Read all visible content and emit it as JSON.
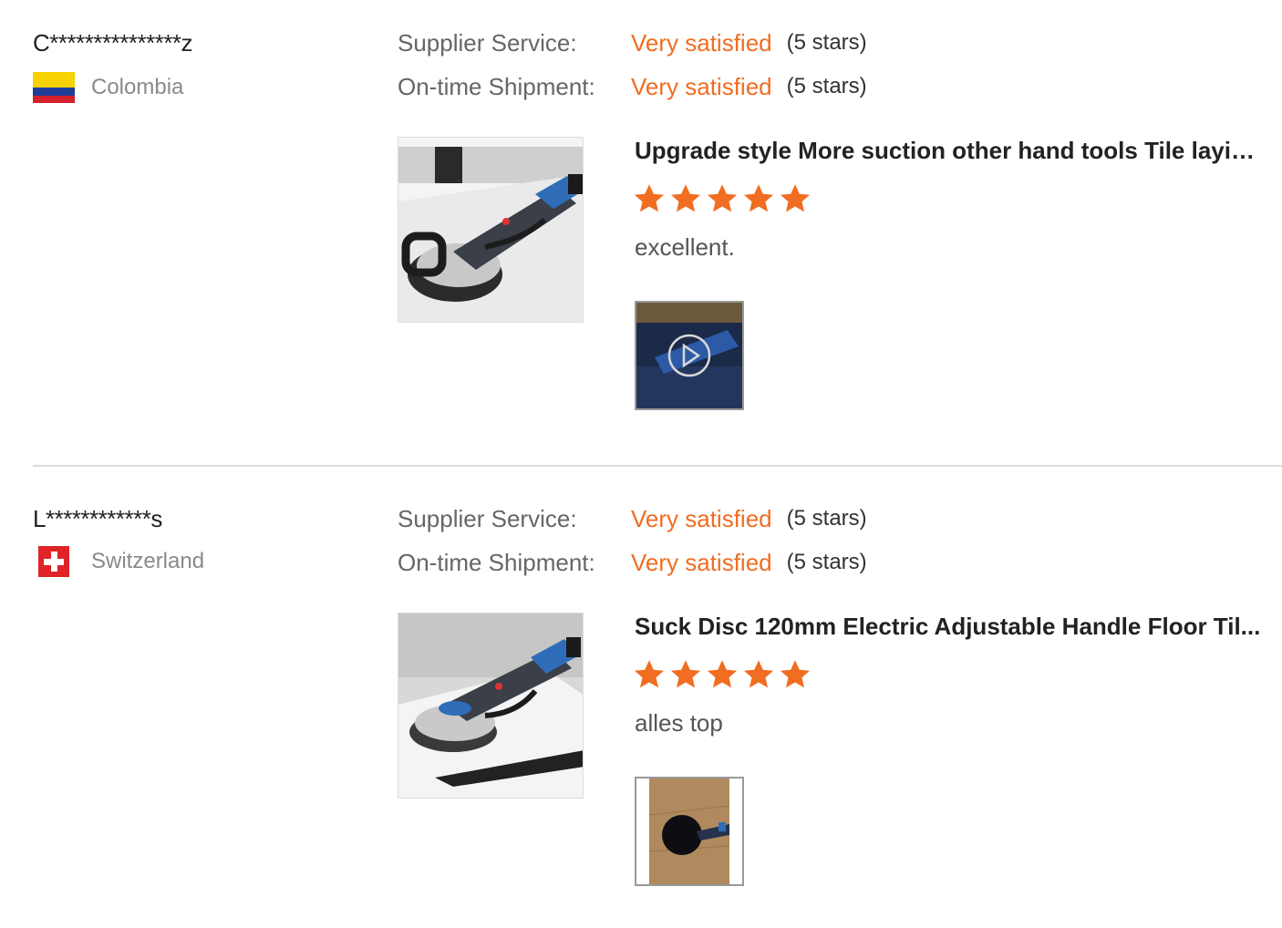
{
  "reviews": [
    {
      "user": "C***************z",
      "country": "Colombia",
      "supplier_service": {
        "label": "Supplier Service:",
        "value": "Very satisfied",
        "stars": "(5 stars)"
      },
      "shipment": {
        "label": "On-time Shipment:",
        "value": "Very satisfied",
        "stars": "(5 stars)"
      },
      "product_title": "Upgrade style More suction other hand tools Tile layin...",
      "rating": 5,
      "comment": "excellent.",
      "media_type": "video"
    },
    {
      "user": "L************s",
      "country": "Switzerland",
      "supplier_service": {
        "label": "Supplier Service:",
        "value": "Very satisfied",
        "stars": "(5 stars)"
      },
      "shipment": {
        "label": "On-time Shipment:",
        "value": "Very satisfied",
        "stars": "(5 stars)"
      },
      "product_title": "Suck Disc 120mm Electric Adjustable Handle Floor Til...",
      "rating": 5,
      "comment": "alles top",
      "media_type": "image"
    }
  ],
  "colors": {
    "accent": "#f06d21",
    "divider": "#dcdcdc"
  },
  "icons": {
    "star": "star-icon",
    "play": "play-icon",
    "flag_co": "colombia-flag-icon",
    "flag_ch": "switzerland-flag-icon"
  }
}
